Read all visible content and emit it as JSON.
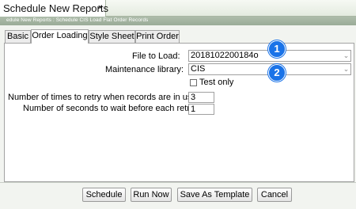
{
  "window": {
    "title": "Schedule New Reports",
    "close_glyph": "×"
  },
  "breadcrumb": "edule New Reports : Schedule CIS Load Flat Order Records",
  "tabs": [
    {
      "label": "Basic",
      "active": false
    },
    {
      "label": "Order Loading",
      "active": true
    },
    {
      "label": "Style Sheet",
      "active": false
    },
    {
      "label": "Print Order",
      "active": false
    }
  ],
  "form": {
    "file_to_load_label": "File to Load:",
    "file_to_load_value": "2018102200184o",
    "maintenance_library_label": "Maintenance library:",
    "maintenance_library_value": "CIS",
    "test_only_label": "Test only",
    "test_only_checked": false,
    "retry_times_label": "Number of times to retry when records are in use:",
    "retry_times_value": "3",
    "retry_wait_label": "Number of seconds to wait before each retry:",
    "retry_wait_value": "1"
  },
  "callouts": [
    "1",
    "2"
  ],
  "buttons": {
    "schedule": "Schedule",
    "run_now": "Run Now",
    "save_as_template": "Save As Template",
    "cancel": "Cancel"
  },
  "icons": {
    "dropdown": "chevron-down-icon",
    "close": "close-icon"
  },
  "colors": {
    "callout": "#1a73e8",
    "breadcrumb_bar": "#a4b4a1"
  }
}
